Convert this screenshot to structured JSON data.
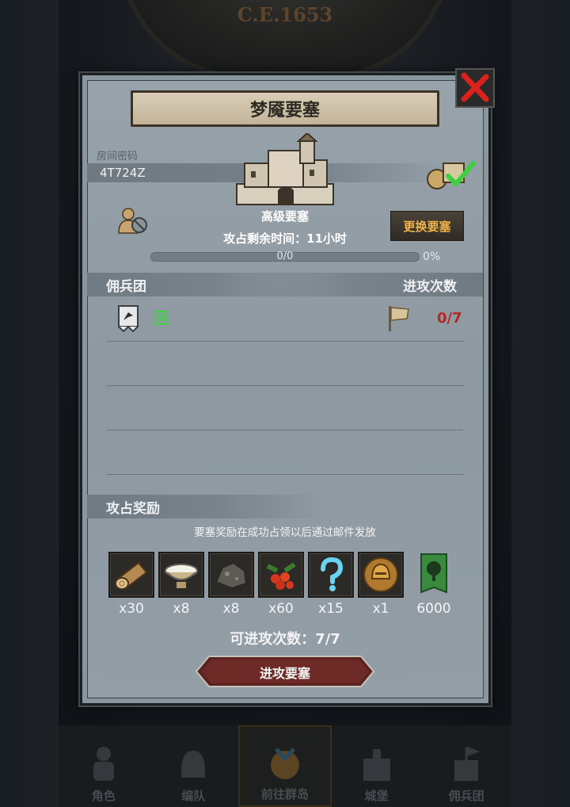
{
  "header": {
    "era": "C.E.1653"
  },
  "dialog": {
    "title": "梦魇要塞",
    "room": {
      "label": "房间密码",
      "code": "4T724Z"
    },
    "fortress": {
      "name": "高级要塞",
      "change_label": "更换要塞"
    },
    "time_left": "攻占剩余时间：11小时",
    "progress": {
      "text": "0/0",
      "percent_label": "0%",
      "fraction": 0
    },
    "mercenary": {
      "title": "佣兵团",
      "count": "0"
    },
    "attacks": {
      "title": "进攻次数",
      "count": "0/7"
    },
    "rewards": {
      "title": "攻占奖励",
      "note": "要塞奖励在成功占领以后通过邮件发放",
      "items": [
        {
          "icon": "wood-log-icon",
          "qty": "x30"
        },
        {
          "icon": "salt-bowl-icon",
          "qty": "x8"
        },
        {
          "icon": "ore-rock-icon",
          "qty": "x8"
        },
        {
          "icon": "berries-icon",
          "qty": "x60"
        },
        {
          "icon": "mystery-question-icon",
          "qty": "x15"
        },
        {
          "icon": "golden-helmet-medal-icon",
          "qty": "x1"
        },
        {
          "icon": "tree-banner-icon",
          "qty": "6000"
        }
      ]
    },
    "attack_available": "可进攻次数：7/7",
    "attack_button": "进攻要塞"
  },
  "bottom_nav": [
    {
      "label": "角色",
      "icon": "knight-icon"
    },
    {
      "label": "编队",
      "icon": "helmet-icon"
    },
    {
      "label": "前往群岛",
      "icon": "island-icon"
    },
    {
      "label": "城堡",
      "icon": "castle-icon"
    },
    {
      "label": "佣兵团",
      "icon": "fortress-flag-icon"
    }
  ],
  "colors": {
    "accent": "#f0b24a",
    "alert": "#b02a24",
    "ok": "#3ed33e"
  }
}
